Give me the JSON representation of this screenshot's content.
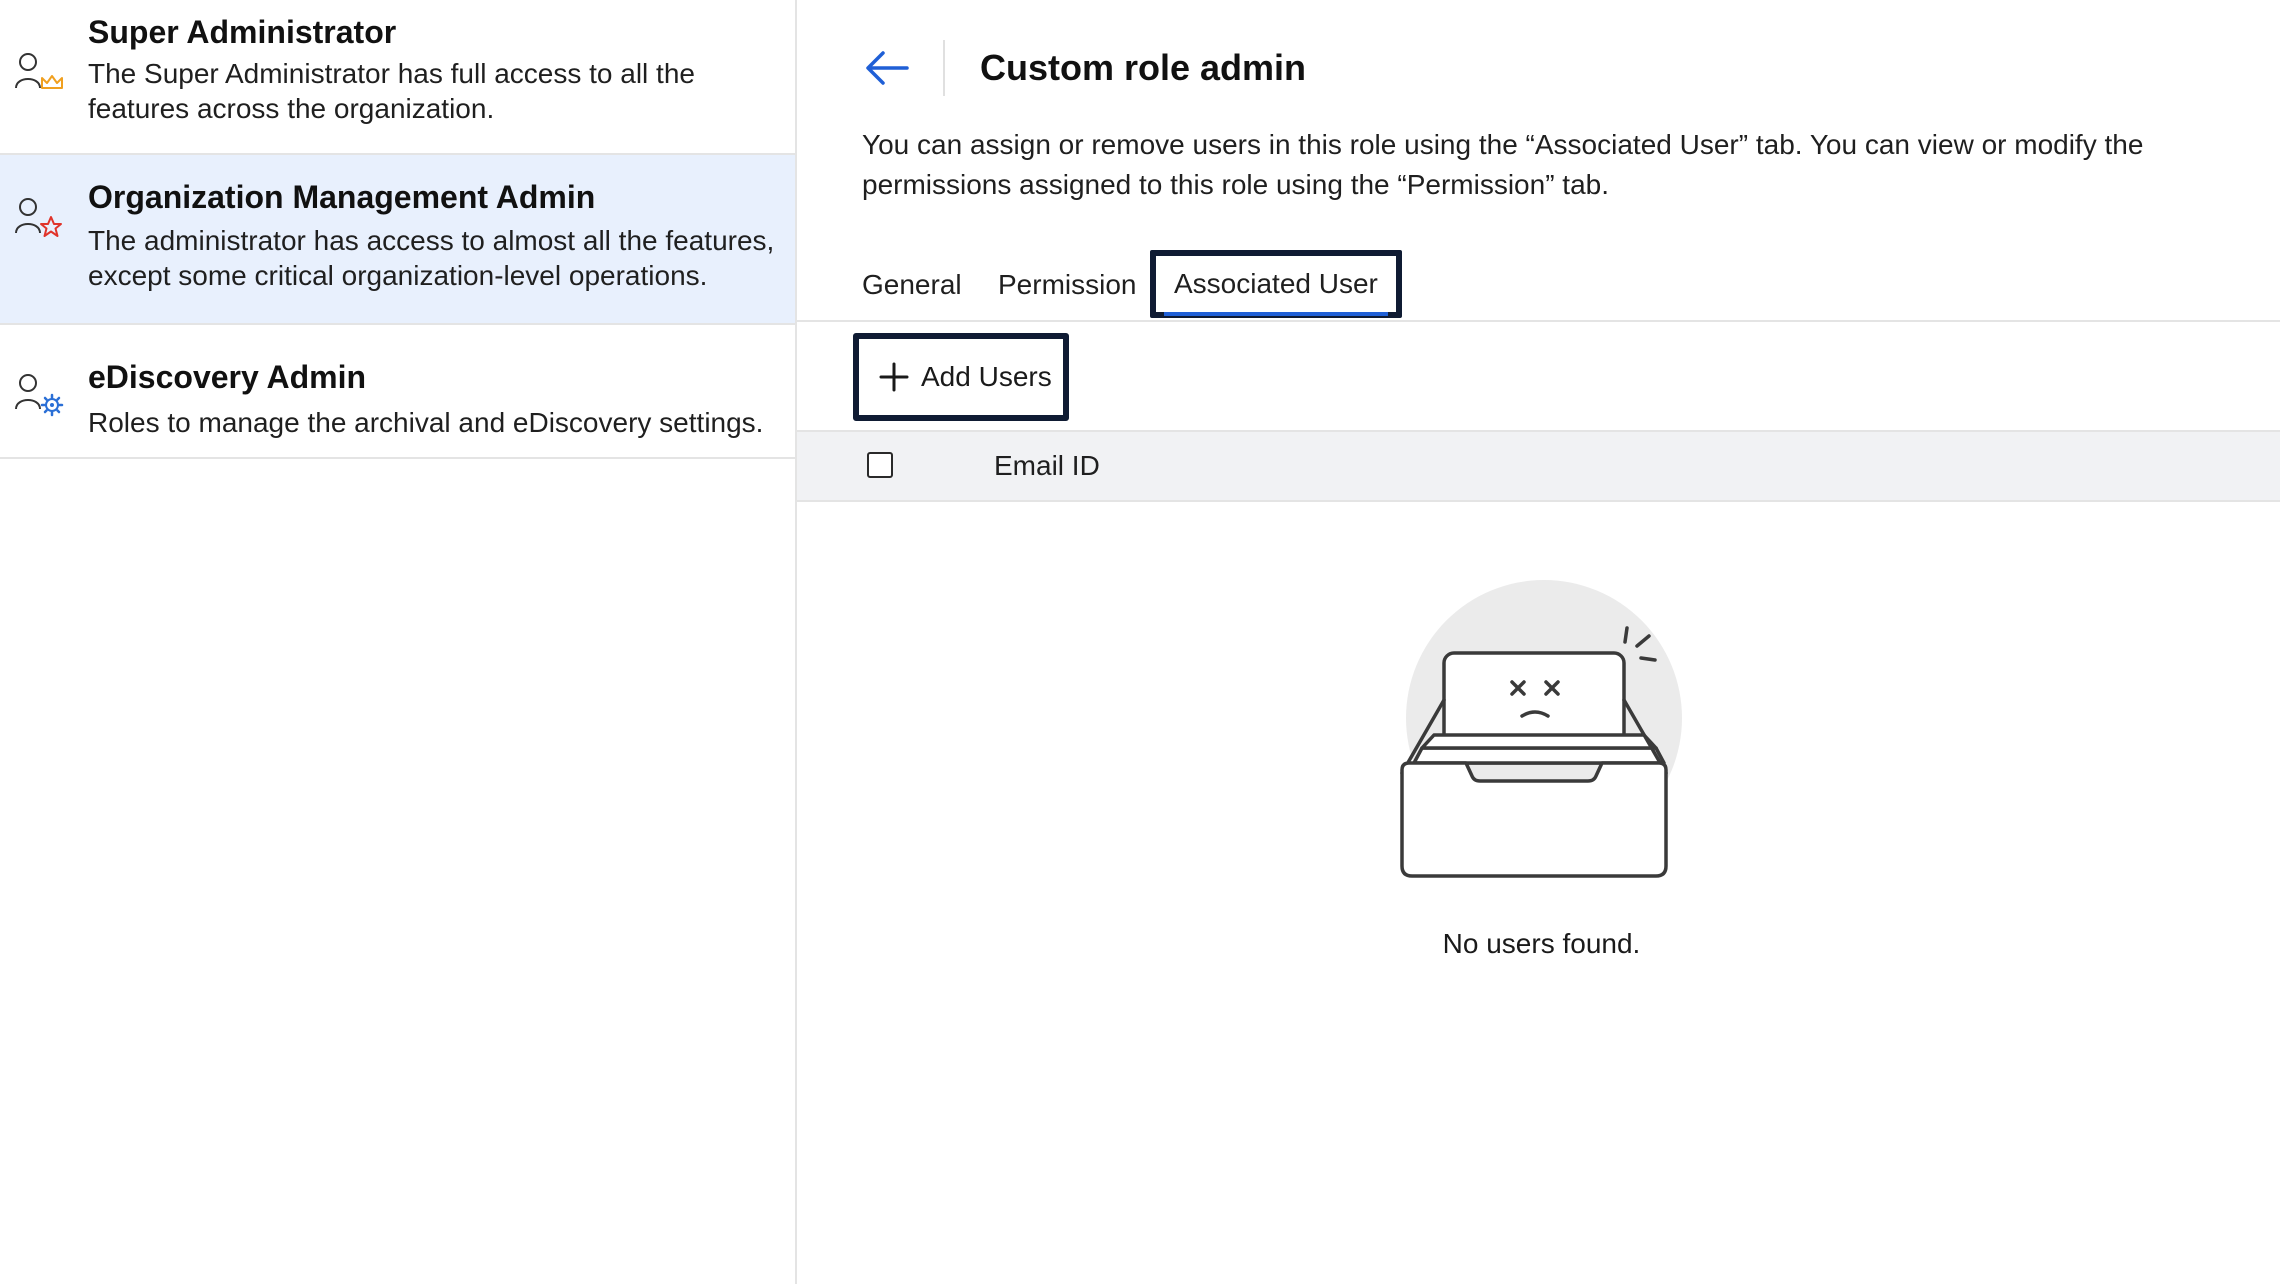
{
  "sidebar": {
    "roles": [
      {
        "title": "Super Administrator",
        "description": "The Super Administrator has full access to all the features across the organization.",
        "icon": "user-crown-icon",
        "selected": false
      },
      {
        "title": "Organization Management Admin",
        "description": "The administrator has access to almost all the features, except some critical organization-level operations.",
        "icon": "user-star-icon",
        "selected": true
      },
      {
        "title": "eDiscovery Admin",
        "description": "Roles to manage the archival and eDiscovery settings.",
        "icon": "user-gear-icon",
        "selected": false
      }
    ]
  },
  "main": {
    "title": "Custom role admin",
    "description": "You can assign or remove users in this role using the “Associated User” tab. You can view or modify the permissions assigned to this role using the “Permission” tab.",
    "tabs": [
      {
        "label": "General",
        "active": false
      },
      {
        "label": "Permission",
        "active": false
      },
      {
        "label": "Associated User",
        "active": true
      }
    ],
    "add_users_label": "Add Users",
    "table": {
      "columns": [
        "Email ID"
      ]
    },
    "empty_message": "No users found."
  },
  "colors": {
    "accent": "#1f5fd6",
    "selected_bg": "#e8f0fd",
    "focus_outline": "#0f1b33",
    "crown": "#f0a020",
    "star": "#e0342b",
    "gear": "#2a6fd6"
  }
}
